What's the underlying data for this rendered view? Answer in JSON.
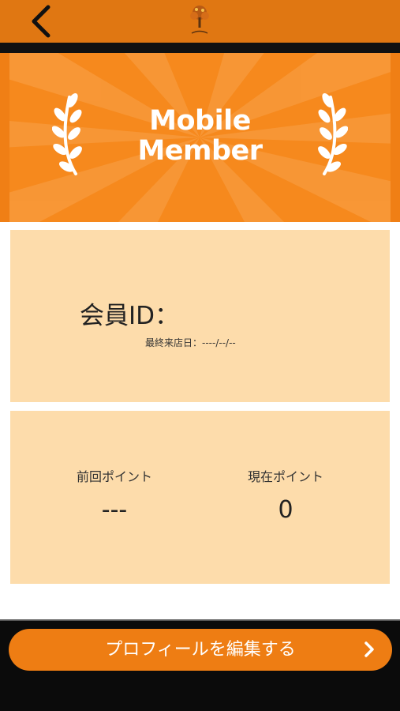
{
  "header": {
    "back_icon": "chevron-left-icon",
    "logo_icon": "tree-logo-icon"
  },
  "banner": {
    "line1": "Mobile",
    "line2": "Member",
    "wreath_icon": "laurel-icon"
  },
  "member": {
    "id_label": "会員ID：",
    "last_visit": "最終来店日：----/--/--"
  },
  "points": {
    "previous_label": "前回ポイント",
    "previous_value": "---",
    "current_label": "現在ポイント",
    "current_value": "0"
  },
  "footer": {
    "edit_label": "プロフィールを編集する",
    "chevron_icon": "chevron-right-icon"
  },
  "colors": {
    "accent": "#e07712",
    "banner": "#f6891d",
    "card": "#fddcab",
    "button": "#ee7d13"
  }
}
